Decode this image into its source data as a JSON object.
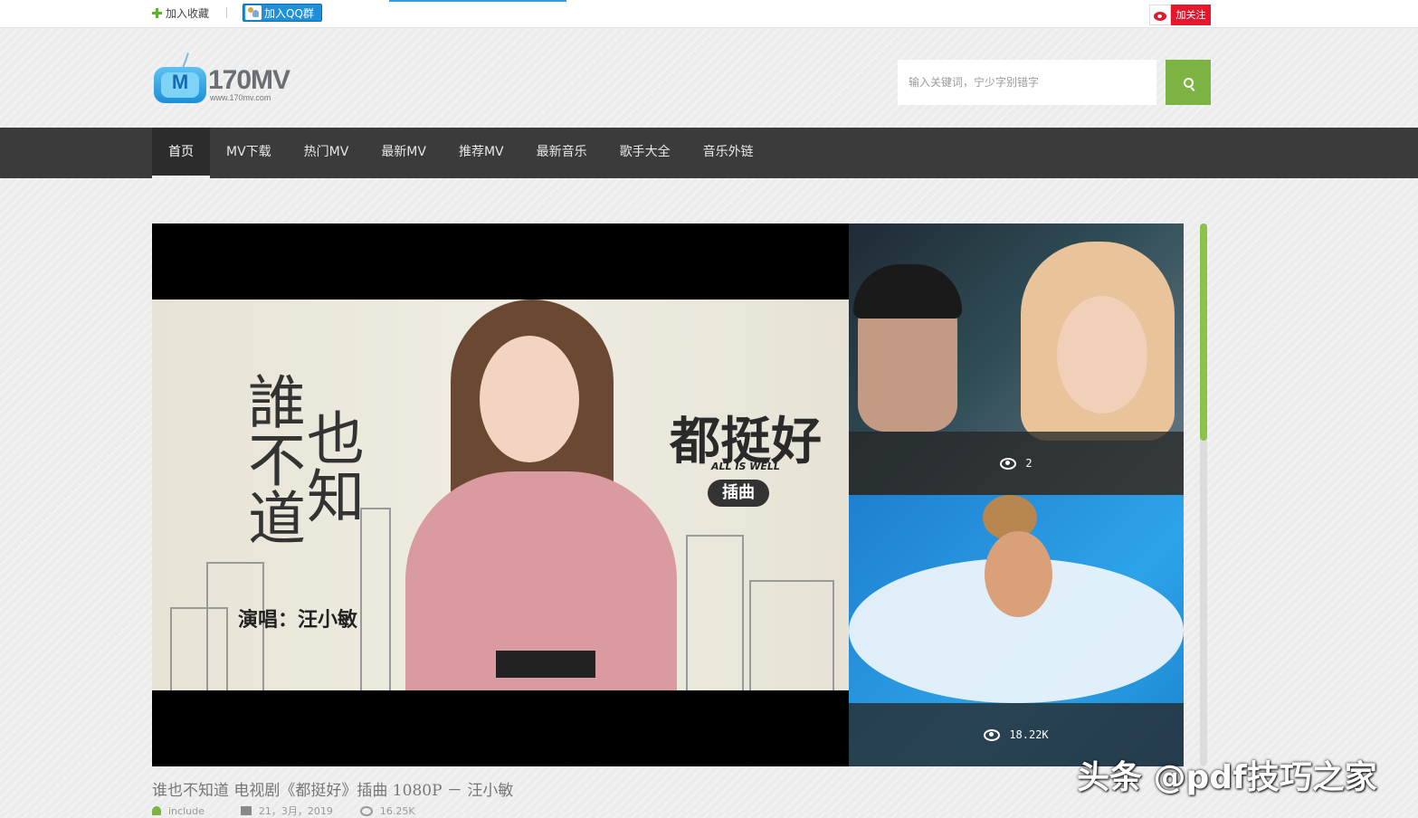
{
  "topbar": {
    "favorite_label": "加入收藏",
    "qq_label": "加入QQ群",
    "weibo_label": "加关注"
  },
  "header": {
    "logo_text": "170MV",
    "logo_letter": "M",
    "logo_url": "www.170mv.com",
    "search_placeholder": "输入关键词，宁少字别错字"
  },
  "nav": {
    "items": [
      "首页",
      "MV下载",
      "热门MV",
      "最新MV",
      "推荐MV",
      "最新音乐",
      "歌手大全",
      "音乐外链"
    ],
    "active_index": 0
  },
  "featured": {
    "poster_title_col1": "誰不道",
    "poster_title_col2": "也知",
    "poster_singer": "演唱：汪小敏",
    "poster_drama": "都挺好",
    "poster_drama_en": "ALL IS WELL",
    "poster_badge": "插曲",
    "caption": "谁也不知道 电视剧《都挺好》插曲 1080P － 汪小敏"
  },
  "side_videos": [
    {
      "views": "2"
    },
    {
      "views": "18.22K"
    }
  ],
  "meta": {
    "uploader": "include",
    "date": "21，3月，2019",
    "views": "16.25K"
  },
  "watermark": "头条 @pdf技巧之家",
  "colors": {
    "accent_green": "#7cb342",
    "nav_bg": "#3b3b3b",
    "qq_blue": "#1f8fd8",
    "weibo_red": "#e6162d"
  }
}
